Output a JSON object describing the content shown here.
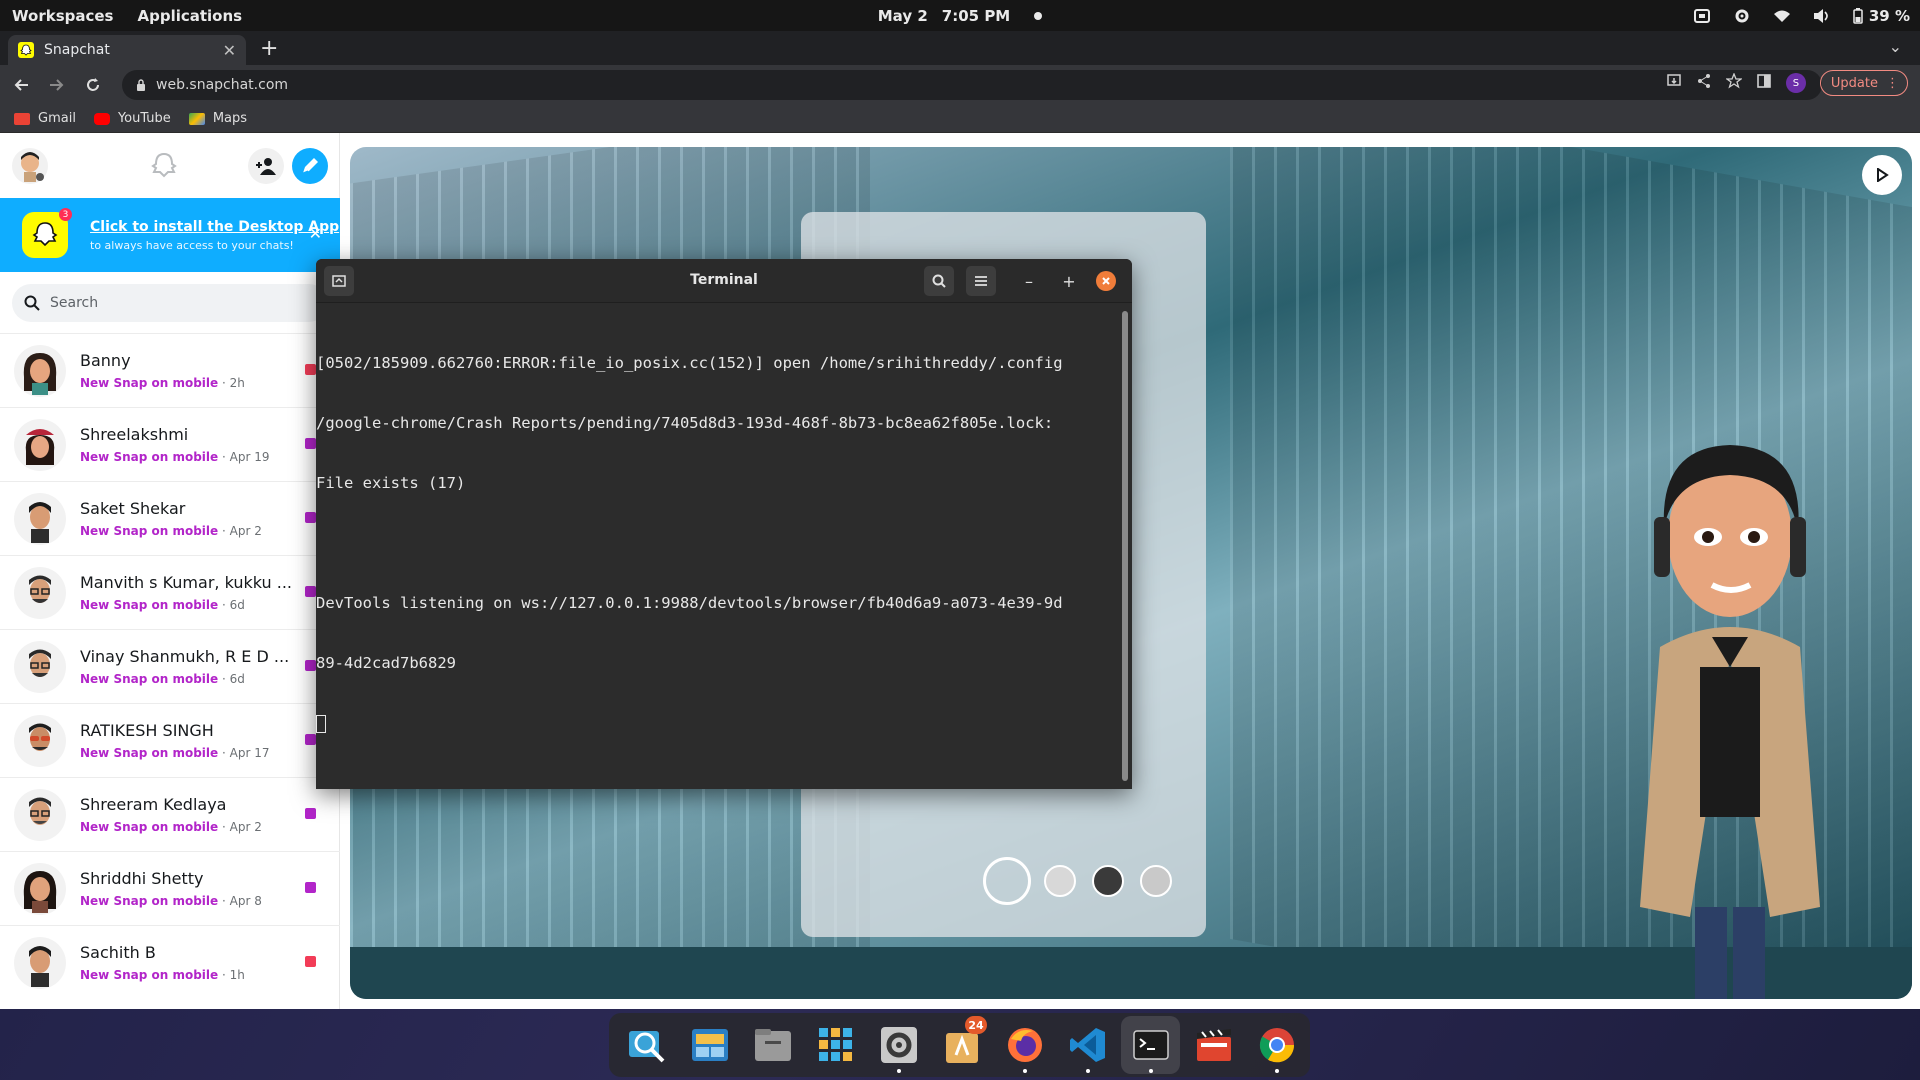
{
  "system_bar": {
    "workspaces": "Workspaces",
    "applications": "Applications",
    "date": "May 2",
    "time": "7:05 PM",
    "battery": "39 %"
  },
  "browser": {
    "tab_title": "Snapchat",
    "url": "web.snapchat.com",
    "update_label": "Update",
    "profile_initial": "S",
    "bookmarks": [
      {
        "label": "Gmail",
        "color": "#ea4335"
      },
      {
        "label": "YouTube",
        "color": "#ff0000"
      },
      {
        "label": "Maps",
        "color": "#34a853"
      }
    ]
  },
  "snapchat": {
    "install_banner": {
      "title": "Click to install the Desktop App",
      "subtitle": "to always have access to your chats!",
      "badge": "3"
    },
    "search_placeholder": "Search",
    "chats": [
      {
        "name": "Banny",
        "status": "New Snap on mobile",
        "time": "2h",
        "color": "#f23c57",
        "avatar": "female-long-hair"
      },
      {
        "name": "Shreelakshmi",
        "status": "New Snap on mobile",
        "time": "Apr 19",
        "color": "#b225c9",
        "avatar": "female-beret"
      },
      {
        "name": "Saket Shekar",
        "status": "New Snap on mobile",
        "time": "Apr 2",
        "color": "#b225c9",
        "avatar": "male-dark-hair"
      },
      {
        "name": "Manvith s Kumar,  kukku ...",
        "status": "New Snap on mobile",
        "time": "6d",
        "color": "#b225c9",
        "avatar": "male-glasses"
      },
      {
        "name": "Vinay Shanmukh,  R E D ...",
        "status": "New Snap on mobile",
        "time": "6d",
        "color": "#b225c9",
        "avatar": "male-glasses"
      },
      {
        "name": "RATIKESH SINGH",
        "status": "New Snap on mobile",
        "time": "Apr 17",
        "color": "#b225c9",
        "avatar": "male-sunglasses"
      },
      {
        "name": "Shreeram Kedlaya",
        "status": "New Snap on mobile",
        "time": "Apr 2",
        "color": "#b225c9",
        "avatar": "male-glasses"
      },
      {
        "name": "Shriddhi Shetty",
        "status": "New Snap on mobile",
        "time": "Apr 8",
        "color": "#b225c9",
        "avatar": "female-long-hair"
      },
      {
        "name": "Sachith B",
        "status": "New Snap on mobile",
        "time": "1h",
        "color": "#f23c57",
        "avatar": "male-dark-hair"
      }
    ]
  },
  "terminal": {
    "title": "Terminal",
    "lines": [
      "[0502/185909.662760:ERROR:file_io_posix.cc(152)] open /home/srihithreddy/.config",
      "/google-chrome/Crash Reports/pending/7405d8d3-193d-468f-8b73-bc8ea62f805e.lock:",
      "File exists (17)",
      "",
      "DevTools listening on ws://127.0.0.1:9988/devtools/browser/fb40d6a9-a073-4e39-9d",
      "89-4d2cad7b6829"
    ]
  },
  "dock": {
    "apps": [
      {
        "name": "search-app-icon",
        "active": false
      },
      {
        "name": "workspaces-app-icon",
        "active": false
      },
      {
        "name": "files-app-icon",
        "active": false
      },
      {
        "name": "app-grid-icon",
        "active": false
      },
      {
        "name": "settings-app-icon",
        "active": true
      },
      {
        "name": "app-store-icon",
        "active": false,
        "badge": "24"
      },
      {
        "name": "firefox-icon",
        "active": true
      },
      {
        "name": "vscode-icon",
        "active": true
      },
      {
        "name": "terminal-app-icon",
        "active": true
      },
      {
        "name": "video-editor-icon",
        "active": false
      },
      {
        "name": "chrome-icon",
        "active": true
      }
    ]
  }
}
